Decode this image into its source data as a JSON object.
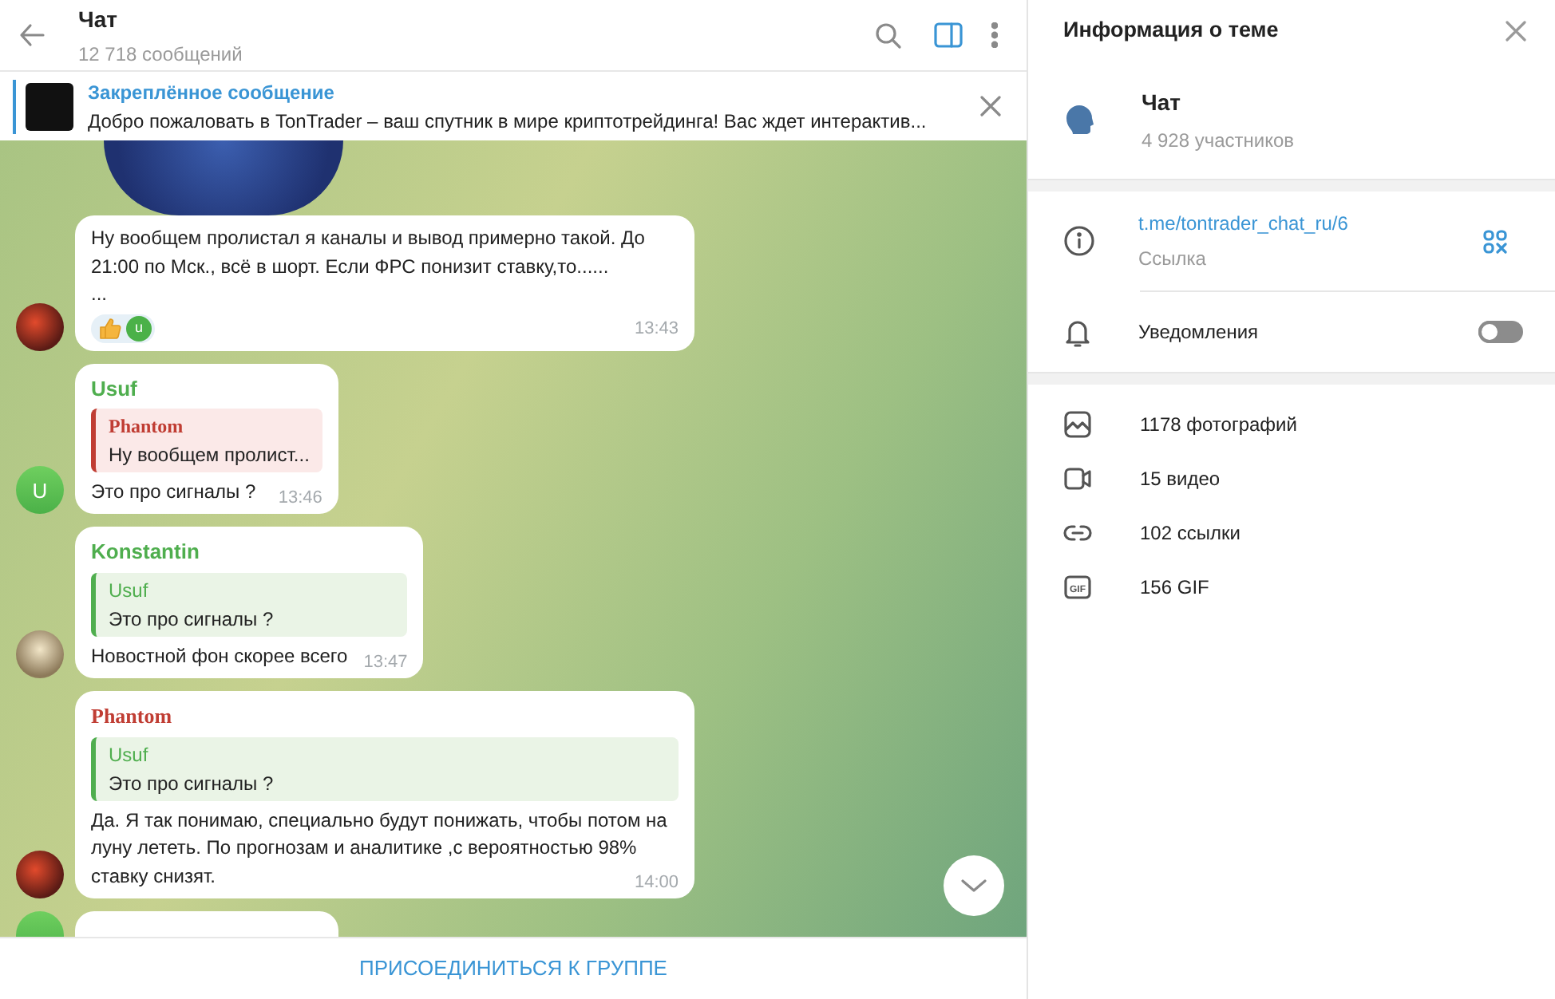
{
  "header": {
    "title": "Чат",
    "subtitle": "12 718 сообщений"
  },
  "pinned": {
    "label": "Закреплённое сообщение",
    "text": "Добро пожаловать в TonTrader – ваш спутник в мире криптотрейдинга!  Вас ждет интерактив..."
  },
  "messages": [
    {
      "kind": "sticker"
    },
    {
      "kind": "text",
      "avatar": {
        "kind": "photo"
      },
      "text": "Ну вообщем пролистал я каналы и вывод примерно такой. До 21:00 по Мск., всё в шорт. Если ФРС понизит ставку,то......\n...",
      "reaction": {
        "user_letter": "u"
      },
      "time": "13:43"
    },
    {
      "kind": "text",
      "sender": "Usuf",
      "color": "#4fae4e",
      "avatar": {
        "kind": "letter",
        "letter": "U"
      },
      "reply": {
        "sender": "Phantom",
        "color": "#c03d33",
        "text": "Ну вообщем пролист..."
      },
      "text": "Это про сигналы ?",
      "time": "13:46"
    },
    {
      "kind": "text",
      "sender": "Konstantin",
      "color": "#4fae4e",
      "avatar": {
        "kind": "photo"
      },
      "reply": {
        "sender": "Usuf",
        "color": "#4fae4e",
        "text": "Это про сигналы ?"
      },
      "text": "Новостной фон скорее всего",
      "time": "13:47"
    },
    {
      "kind": "text",
      "sender": "Phantom",
      "color": "#c03d33",
      "avatar": {
        "kind": "photo"
      },
      "reply": {
        "sender": "Usuf",
        "color": "#4fae4e",
        "text": "Это про сигналы ?"
      },
      "text": "Да. Я так понимаю, специально будут понижать, чтобы потом на луну лететь. По прогнозам и аналитике ,с вероятностью 98% ставку снизят.",
      "time": "14:00"
    },
    {
      "kind": "partial",
      "avatar": {
        "kind": "letter"
      }
    }
  ],
  "join_button": "ПРИСОЕДИНИТЬСЯ К ГРУППЕ",
  "info": {
    "title": "Информация о теме",
    "chat_name": "Чат",
    "members": "4 928 участников",
    "link": "t.me/tontrader_chat_ru/6",
    "link_label": "Ссылка",
    "notifications": {
      "label": "Уведомления",
      "on": false
    },
    "media": [
      {
        "kind": "photo",
        "label": "1178 фотографий"
      },
      {
        "kind": "video",
        "label": "15 видео"
      },
      {
        "kind": "link",
        "label": "102 ссылки"
      },
      {
        "kind": "gif",
        "icon_text": "GIF",
        "label": "156 GIF"
      }
    ]
  }
}
